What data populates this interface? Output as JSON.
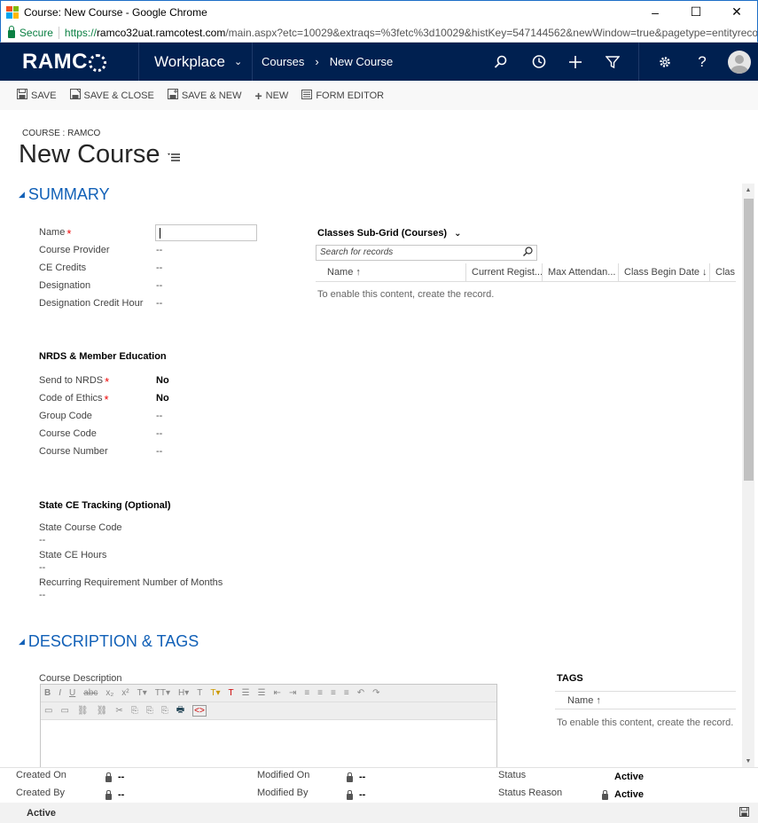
{
  "window": {
    "title": "Course: New Course - Google Chrome",
    "controls": [
      "–",
      "☐",
      "✕"
    ]
  },
  "browser": {
    "secure_label": "Secure",
    "url_scheme": "https://",
    "url_host": "ramco32uat.ramcotest.com",
    "url_rest": "/main.aspx?etc=10029&extraqs=%3fetc%3d10029&histKey=547144562&newWindow=true&pagetype=entityreco..."
  },
  "nav": {
    "logo_left": "RAMC",
    "workplace_label": "Workplace",
    "breadcrumb": [
      "Courses",
      "New Course"
    ],
    "icons": [
      "search-icon",
      "history-icon",
      "plus-icon",
      "filter-icon",
      "gear-icon",
      "help-icon"
    ],
    "help_glyph": "?"
  },
  "commands": [
    {
      "label": "SAVE",
      "icon": "save-icon"
    },
    {
      "label": "SAVE & CLOSE",
      "icon": "save-close-icon"
    },
    {
      "label": "SAVE & NEW",
      "icon": "save-new-icon"
    },
    {
      "label": "NEW",
      "icon": "plus-icon"
    },
    {
      "label": "FORM EDITOR",
      "icon": "form-editor-icon"
    }
  ],
  "header": {
    "entity_label": "COURSE : RAMCO",
    "title": "New Course"
  },
  "summary": {
    "title": "SUMMARY",
    "fields": [
      {
        "label": "Name",
        "value": "",
        "required": true
      },
      {
        "label": "Course Provider",
        "value": "--"
      },
      {
        "label": "CE Credits",
        "value": "--"
      },
      {
        "label": "Designation",
        "value": "--"
      },
      {
        "label": "Designation Credit Hour",
        "value": "--"
      }
    ],
    "nrds": {
      "title": "NRDS & Member Education",
      "fields": [
        {
          "label": "Send to NRDS",
          "value": "No",
          "required": true
        },
        {
          "label": "Code of Ethics",
          "value": "No",
          "required": true
        },
        {
          "label": "Group Code",
          "value": "--"
        },
        {
          "label": "Course Code",
          "value": "--"
        },
        {
          "label": "Course Number",
          "value": "--"
        }
      ]
    },
    "state": {
      "title": "State CE Tracking (Optional)",
      "fields": [
        {
          "label": "State Course Code",
          "value": "--"
        },
        {
          "label": "State CE Hours",
          "value": "--"
        },
        {
          "label": "Recurring Requirement Number of Months",
          "value": "--"
        }
      ]
    },
    "subgrid": {
      "title": "Classes Sub-Grid (Courses)",
      "search_placeholder": "Search for records",
      "columns": [
        "Name ↑",
        "Current Regist...",
        "Max Attendan...",
        "Class Begin Date ↓",
        "Clas"
      ],
      "empty_text": "To enable this content, create the record."
    }
  },
  "description": {
    "title": "DESCRIPTION & TAGS",
    "course_description_label": "Course Description",
    "toolbar1": [
      "B",
      "I",
      "U",
      "abc",
      "x₂",
      "x²",
      "T▾",
      "TT▾",
      "H▾",
      "T",
      "T▾",
      "T",
      "☰",
      "☰",
      "⇤",
      "⇥",
      "≡",
      "≡",
      "≡",
      "≡",
      "↶",
      "↷"
    ],
    "toolbar2": [
      "▭",
      "▭",
      "⛓",
      "⛓",
      "✂",
      "⎘",
      "⎘",
      "⎘",
      "🖶",
      "<>"
    ],
    "tags": {
      "title": "TAGS",
      "column": "Name ↑",
      "empty_text": "To enable this content, create the record."
    }
  },
  "footer": {
    "created_on": {
      "label": "Created On",
      "value": "--"
    },
    "created_by": {
      "label": "Created By",
      "value": "--"
    },
    "modified_on": {
      "label": "Modified On",
      "value": "--"
    },
    "modified_by": {
      "label": "Modified By",
      "value": "--"
    },
    "status": {
      "label": "Status",
      "value": "Active"
    },
    "status_reason": {
      "label": "Status Reason",
      "value": "Active"
    }
  },
  "statusbar": {
    "label": "Active"
  },
  "colors": {
    "nav_bg": "#002050",
    "section_blue": "#1160b7",
    "required_red": "#e00000",
    "secure_green": "#0b8043"
  }
}
